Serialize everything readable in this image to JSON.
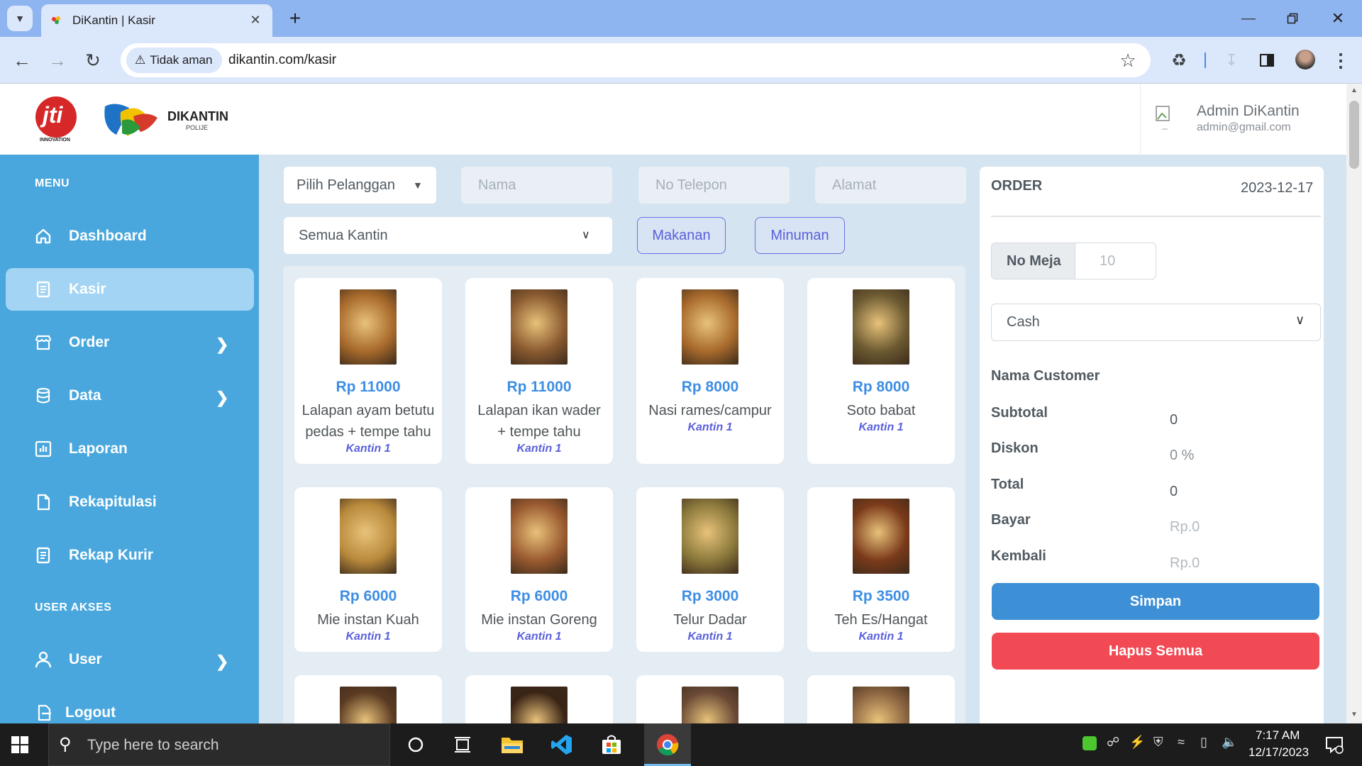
{
  "browser": {
    "tab_title": "DiKantin | Kasir",
    "security_label": "Tidak aman",
    "url": "dikantin.com/kasir"
  },
  "header": {
    "logo_jti": "jti",
    "logo_jti_sub": "INNOVATION",
    "logo_brand": "DIKANTIN",
    "logo_brand_sub": "POLIJE",
    "user_name": "Admin DiKantin",
    "user_email": "admin@gmail.com"
  },
  "sidebar": {
    "menu_heading": "MENU",
    "user_heading": "USER AKSES",
    "items": [
      {
        "label": "Dashboard",
        "icon": "home-icon"
      },
      {
        "label": "Kasir",
        "icon": "receipt-icon"
      },
      {
        "label": "Order",
        "icon": "store-icon"
      },
      {
        "label": "Data",
        "icon": "database-icon"
      },
      {
        "label": "Laporan",
        "icon": "chart-icon"
      },
      {
        "label": "Rekapitulasi",
        "icon": "document-icon"
      },
      {
        "label": "Rekap Kurir",
        "icon": "receipt-icon"
      },
      {
        "label": "User",
        "icon": "user-icon"
      },
      {
        "label": "Logout",
        "icon": "logout-icon"
      }
    ]
  },
  "customer_form": {
    "select_customer": "Pilih Pelanggan",
    "name_placeholder": "Nama",
    "phone_placeholder": "No Telepon",
    "address_placeholder": "Alamat",
    "kantin_select": "Semua Kantin",
    "filter_food": "Makanan",
    "filter_drink": "Minuman"
  },
  "products": [
    {
      "price": "Rp 11000",
      "name": "Lalapan ayam betutu pedas + tempe tahu",
      "kantin": "Kantin 1",
      "color": "#a86a2c"
    },
    {
      "price": "Rp 11000",
      "name": "Lalapan ikan wader + tempe tahu",
      "kantin": "Kantin 1",
      "color": "#8a5a30"
    },
    {
      "price": "Rp 8000",
      "name": "Nasi rames/campur",
      "kantin": "Kantin 1",
      "color": "#a86a2c"
    },
    {
      "price": "Rp 8000",
      "name": "Soto babat",
      "kantin": "Kantin 1",
      "color": "#6c5a32"
    },
    {
      "price": "Rp 6000",
      "name": "Mie instan Kuah",
      "kantin": "Kantin 1",
      "color": "#b98a3c"
    },
    {
      "price": "Rp 6000",
      "name": "Mie instan Goreng",
      "kantin": "Kantin 1",
      "color": "#9a5a30"
    },
    {
      "price": "Rp 3000",
      "name": "Telur Dadar",
      "kantin": "Kantin 1",
      "color": "#8c7a3c"
    },
    {
      "price": "Rp 3500",
      "name": "Teh Es/Hangat",
      "kantin": "Kantin 1",
      "color": "#7a3a1a"
    },
    {
      "color": "#5a3a22"
    },
    {
      "color": "#3a2416"
    },
    {
      "color": "#6a4a36"
    },
    {
      "color": "#8a6440"
    }
  ],
  "order": {
    "title": "ORDER",
    "date": "2023-12-17",
    "table_label": "No Meja",
    "table_placeholder": "10",
    "payment_method": "Cash",
    "customer_label": "Nama Customer",
    "subtotal_label": "Subtotal",
    "subtotal_value": "0",
    "discount_label": "Diskon",
    "discount_value": "0 %",
    "total_label": "Total",
    "total_value": "0",
    "pay_label": "Bayar",
    "pay_placeholder": "Rp.0",
    "change_label": "Kembali",
    "change_placeholder": "Rp.0",
    "save_button": "Simpan",
    "clear_button": "Hapus Semua"
  },
  "taskbar": {
    "search_placeholder": "Type here to search",
    "time": "7:17 AM",
    "date": "12/17/2023"
  },
  "colors": {
    "sidebar": "#49a7dd",
    "accent_blue": "#3d8ee5",
    "danger": "#f24a54",
    "pill": "#5a60dc"
  }
}
